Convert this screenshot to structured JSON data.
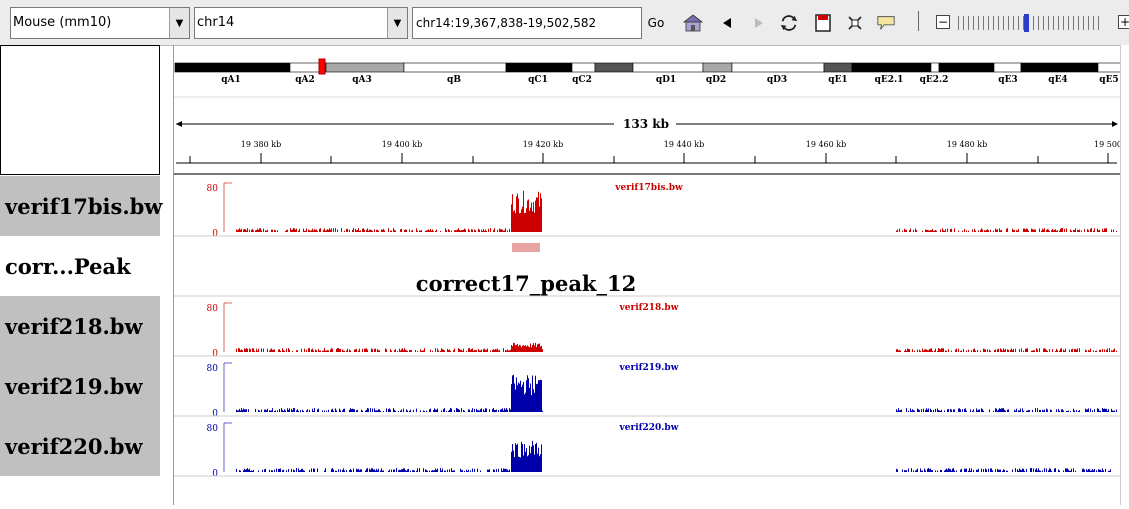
{
  "toolbar": {
    "genome": "Mouse (mm10)",
    "chromosome": "chr14",
    "locus": "chr14:19,367,838-19,502,582",
    "go_label": "Go"
  },
  "icons": {
    "home": "home-icon",
    "back": "back-icon",
    "forward": "forward-icon",
    "refresh": "refresh-icon",
    "roi": "region-of-interest-icon",
    "fit": "fit-window-icon",
    "popup": "popup-text-icon",
    "zoom_out": "zoom-out-icon",
    "zoom_in": "zoom-in-icon"
  },
  "zoom": {
    "level": 0.47
  },
  "ideogram": {
    "bands": [
      "qA1",
      "qA2",
      "qA3",
      "qB",
      "qC1",
      "qC2",
      "qD1",
      "qD2",
      "qD3",
      "qE1",
      "qE2.1",
      "qE2.2",
      "qE3",
      "qE4",
      "qE5"
    ]
  },
  "ruler": {
    "span": "133 kb",
    "ticks": [
      "19 380 kb",
      "19 400 kb",
      "19 420 kb",
      "19 440 kb",
      "19 460 kb",
      "19 480 kb",
      "19 500"
    ]
  },
  "tracks": [
    {
      "name": "verif17bis.bw",
      "label": "verif17bis.bw",
      "scale_max": "80",
      "scale_min": "0",
      "color": "#cc0000"
    },
    {
      "name": "corr...Peak",
      "feature": "correct17_peak_12",
      "color": "#e8a3a3"
    },
    {
      "name": "verif218.bw",
      "label": "verif218.bw",
      "scale_max": "80",
      "scale_min": "0",
      "color": "#cc0000"
    },
    {
      "name": "verif219.bw",
      "label": "verif219.bw",
      "scale_max": "80",
      "scale_min": "0",
      "color": "#0000aa"
    },
    {
      "name": "verif220.bw",
      "label": "verif220.bw",
      "scale_max": "80",
      "scale_min": "0",
      "color": "#0000aa"
    }
  ]
}
